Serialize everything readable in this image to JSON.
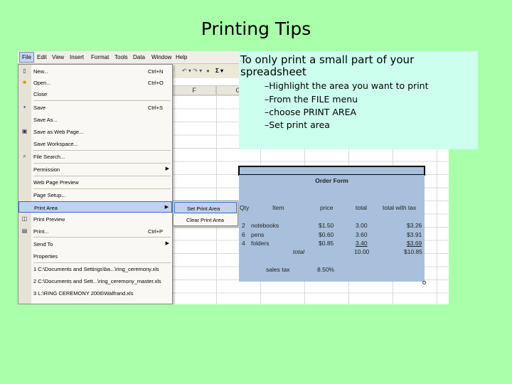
{
  "slide": {
    "title": "Printing Tips"
  },
  "excel": {
    "menubar": [
      "File",
      "Edit",
      "View",
      "Insert",
      "Format",
      "Tools",
      "Data",
      "Window",
      "Help"
    ],
    "columns": [
      "F",
      "G"
    ]
  },
  "file_menu": {
    "items": [
      {
        "label": "New...",
        "shortcut": "Ctrl+N",
        "icon": "new-doc-icon"
      },
      {
        "label": "Open...",
        "shortcut": "Ctrl+O",
        "icon": "open-folder-icon"
      },
      {
        "label": "Close",
        "shortcut": "",
        "icon": ""
      },
      {
        "label": "Save",
        "shortcut": "Ctrl+S",
        "icon": "save-icon"
      },
      {
        "label": "Save As...",
        "shortcut": "",
        "icon": ""
      },
      {
        "label": "Save as Web Page...",
        "shortcut": "",
        "icon": "web-page-icon"
      },
      {
        "label": "Save Workspace...",
        "shortcut": "",
        "icon": ""
      },
      {
        "label": "File Search...",
        "shortcut": "",
        "icon": "search-icon"
      },
      {
        "label": "Permission",
        "shortcut": "",
        "icon": ""
      },
      {
        "label": "Web Page Preview",
        "shortcut": "",
        "icon": ""
      },
      {
        "label": "Page Setup...",
        "shortcut": "",
        "icon": ""
      },
      {
        "label": "Print Area",
        "shortcut": "",
        "icon": ""
      },
      {
        "label": "Print Preview",
        "shortcut": "",
        "icon": "print-preview-icon"
      },
      {
        "label": "Print...",
        "shortcut": "Ctrl+P",
        "icon": "print-icon"
      },
      {
        "label": "Send To",
        "shortcut": "",
        "icon": ""
      },
      {
        "label": "Properties",
        "shortcut": "",
        "icon": ""
      },
      {
        "label": "1 C:\\Documents and Settings\\ba...\\ring_ceremony.xls",
        "shortcut": "",
        "icon": ""
      },
      {
        "label": "2 C:\\Documents and Sett...\\ring_ceremony_master.xls",
        "shortcut": "",
        "icon": ""
      },
      {
        "label": "3 L:\\RING CEREMONY 2006\\Walfrand.xls",
        "shortcut": "",
        "icon": ""
      }
    ],
    "submenu": [
      "Set Print Area",
      "Clear Print Area"
    ]
  },
  "order_form": {
    "title": "Order Form",
    "headers": [
      "Qty",
      "Item",
      "price",
      "total",
      "total with tax"
    ],
    "rows": [
      {
        "qty": "2",
        "item": "notebooks",
        "price": "$1.50",
        "total": "3.00",
        "tax": "$3.26"
      },
      {
        "qty": "6",
        "item": "pens",
        "price": "$0.60",
        "total": "3.60",
        "tax": "$3.91"
      },
      {
        "qty": "4",
        "item": "folders",
        "price": "$0.85",
        "total": "3.40",
        "tax": "$3.69"
      }
    ],
    "total_label": "total",
    "total_value": "10.00",
    "total_tax": "$10.85",
    "sales_tax_label": "sales tax",
    "sales_tax_value": "8.50%"
  },
  "callout": {
    "main": "To only print a small part of your spreadsheet",
    "steps": [
      "–Highlight the area you want to print",
      "–From the FILE menu",
      "–choose PRINT AREA",
      "–Set print area"
    ]
  }
}
